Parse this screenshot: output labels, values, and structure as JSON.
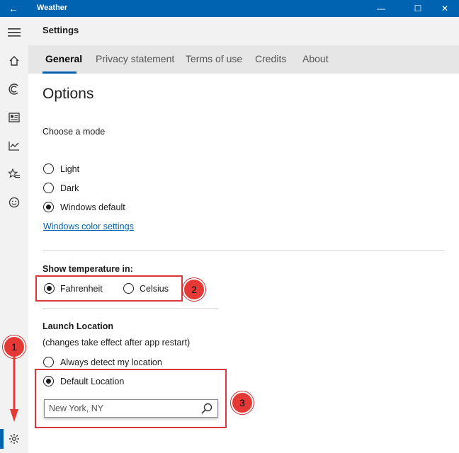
{
  "window": {
    "title": "Weather",
    "back_glyph": "←",
    "minimize_glyph": "—",
    "maximize_glyph": "☐",
    "close_glyph": "✕"
  },
  "header": {
    "title": "Settings"
  },
  "sidebar": {
    "items": [
      "menu-icon",
      "home-icon",
      "forecast-icon",
      "news-icon",
      "historical-icon",
      "favorites-icon",
      "feedback-icon",
      "settings-icon"
    ]
  },
  "tabs": [
    {
      "label": "General",
      "active": true
    },
    {
      "label": "Privacy statement",
      "active": false
    },
    {
      "label": "Terms of use",
      "active": false
    },
    {
      "label": "Credits",
      "active": false
    },
    {
      "label": "About",
      "active": false
    }
  ],
  "options": {
    "title": "Options",
    "mode_label": "Choose a mode",
    "modes": [
      {
        "label": "Light",
        "checked": false
      },
      {
        "label": "Dark",
        "checked": false
      },
      {
        "label": "Windows default",
        "checked": true
      }
    ],
    "color_link": "Windows color settings"
  },
  "temperature": {
    "label": "Show temperature in:",
    "units": [
      {
        "label": "Fahrenheit",
        "checked": true
      },
      {
        "label": "Celsius",
        "checked": false
      }
    ]
  },
  "launch": {
    "label": "Launch Location",
    "note": "(changes take effect after app restart)",
    "options": [
      {
        "label": "Always detect my location",
        "checked": false
      },
      {
        "label": "Default Location",
        "checked": true
      }
    ],
    "location_value": "New York, NY"
  },
  "annotations": [
    "1",
    "2",
    "3"
  ],
  "colors": {
    "accent": "#0063b1",
    "annotation": "#e53935"
  }
}
